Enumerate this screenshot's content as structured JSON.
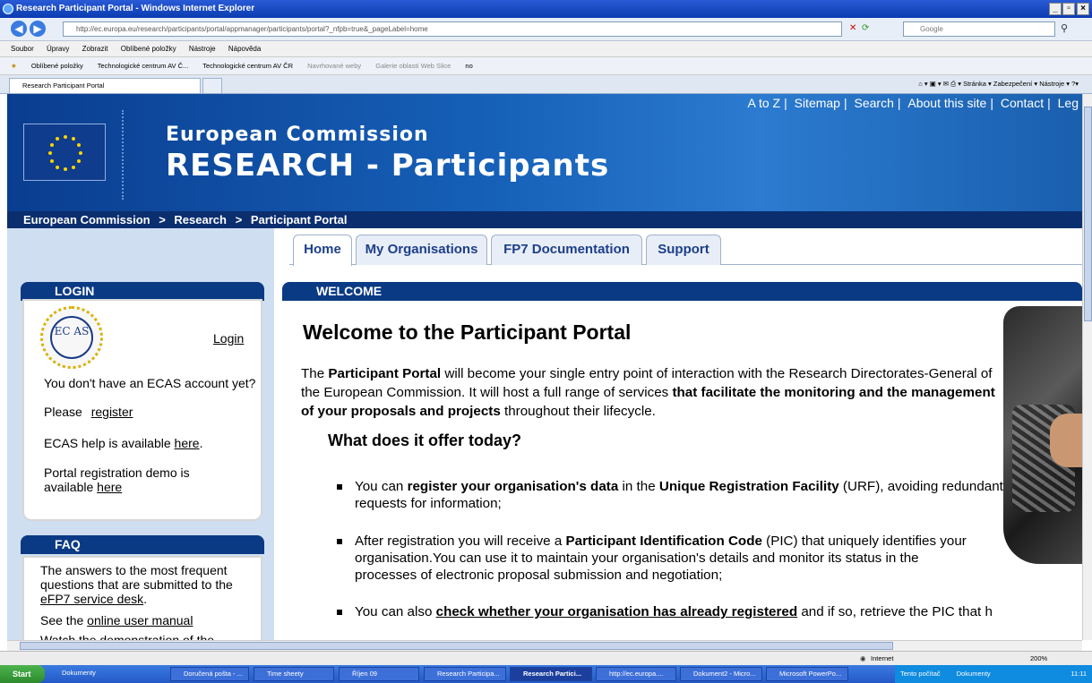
{
  "window": {
    "title": "Research Participant Portal - Windows Internet Explorer",
    "address": "http://ec.europa.eu/research/participants/portal/appmanager/participants/portal?_nfpb=true&_pageLabel=home",
    "search_placeholder": "Google",
    "menu": [
      "Soubor",
      "Úpravy",
      "Zobrazit",
      "Oblíbené položky",
      "Nástroje",
      "Nápověda"
    ],
    "favorites": [
      "Oblíbené položky",
      "Technologické centrum AV Č...",
      "Technologické centrum AV ČR",
      "Navrhované weby",
      "Galerie oblastí Web Slice",
      "no"
    ],
    "tab_label": "Research Participant Portal",
    "tab_tools": [
      "Stránka",
      "Zabezpečení",
      "Nástroje"
    ]
  },
  "header": {
    "top_links": [
      "A to Z",
      "Sitemap",
      "Search",
      "About this site",
      "Contact",
      "Leg"
    ],
    "title_line1": "European Commission",
    "title_line2": "RESEARCH - Participants",
    "breadcrumb": [
      "European Commission",
      ">",
      "Research",
      ">",
      "Participant Portal"
    ]
  },
  "tabs": [
    {
      "label": "Home"
    },
    {
      "label": "My Organisations"
    },
    {
      "label": "FP7 Documentation"
    },
    {
      "label": "Support"
    }
  ],
  "login": {
    "heading": "LOGIN",
    "ecas_logo_text": "EC AS",
    "login_link": "Login",
    "no_account": "You don't have an ECAS account yet?",
    "please": "Please",
    "register_link": "register",
    "help_text": "ECAS help is available",
    "help_link": "here",
    "demo_text": "Portal registration demo is available",
    "demo_link": "here"
  },
  "faq": {
    "heading": "FAQ",
    "text": "The answers to the most frequent questions that are submitted to the",
    "servicedesk_link": "eFP7 service desk",
    "see_the": "See the",
    "manual_link": "online user manual",
    "cut_text": "Watch the demonstration of the"
  },
  "welcome": {
    "heading": "WELCOME",
    "title": "Welcome to the Participant Portal",
    "intro_a": "The ",
    "intro_b": "Participant Portal",
    "intro_c": " will become your single entry point of interaction with the Research Directorates-General of the European Commission. It will host a full range of services ",
    "intro_d": "that facilitate the monitoring and the management of your proposals and projects",
    "intro_e": " throughout their lifecycle.",
    "offer_heading": "What does it offer today?",
    "b1_a": "You can ",
    "b1_b": "register your organisation's data",
    "b1_c": " in the ",
    "b1_d": "Unique Registration Facility",
    "b1_e": " (URF), avoiding redundant requests for information;",
    "b2_a": "After registration you will receive a ",
    "b2_b": "Participant Identification Code",
    "b2_c": " (PIC) that uniquely identifies your organisation.You can use it to maintain your organisation's details and monitor its status in the processes of electronic proposal submission and negotiation;",
    "b3_a": "You can also ",
    "b3_b": "check whether your organisation has already registered",
    "b3_c": " and if so, retrieve the PIC that h"
  },
  "status": {
    "zone": "Internet",
    "zoom": "200%"
  },
  "taskbar": {
    "start": "Start",
    "items": [
      "Dokumenty",
      "Doručená pošta - ...",
      "Time sheety",
      "Říjen 09",
      "Research Participa...",
      "Research Partici...",
      "http://ec.europa....",
      "Dokument2 - Micro...",
      "Microsoft PowerPo..."
    ],
    "tray_items": [
      "Tento počítač",
      "Dokumenty"
    ],
    "clock": "11:11"
  },
  "colors": {
    "banner": "#1660b8",
    "navy": "#0b3a85",
    "left_column": "#cfdff1",
    "tab_text": "#1d3f8a"
  }
}
